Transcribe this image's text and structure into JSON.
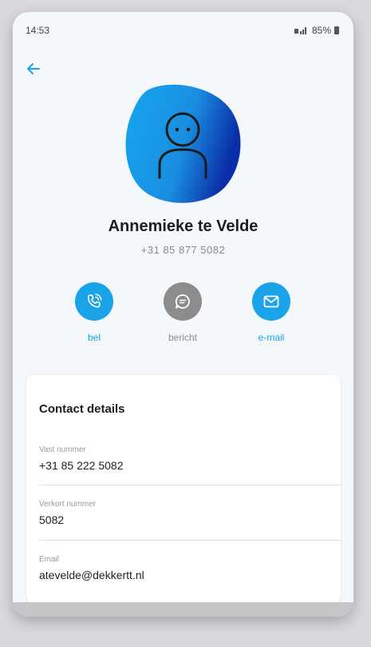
{
  "status": {
    "time": "14:53",
    "battery": "85%"
  },
  "contact": {
    "name": "Annemieke te Velde",
    "phone": "+31 85 877 5082"
  },
  "actions": [
    {
      "label": "bel",
      "icon": "phone-icon",
      "color": "#1aa3e8"
    },
    {
      "label": "bericht",
      "icon": "message-icon",
      "color": "#8c8c8c"
    },
    {
      "label": "e-mail",
      "icon": "email-icon",
      "color": "#1aa3e8"
    }
  ],
  "details": {
    "title": "Contact details",
    "fields": [
      {
        "label": "Vast nummer",
        "value": "+31 85 222 5082"
      },
      {
        "label": "Verkort nummer",
        "value": "5082"
      },
      {
        "label": "Email",
        "value": "atevelde@dekkertt.nl"
      }
    ]
  },
  "colors": {
    "accent": "#1aa3e8",
    "muted": "#8c8c8c",
    "background": "#f5f8fb"
  }
}
